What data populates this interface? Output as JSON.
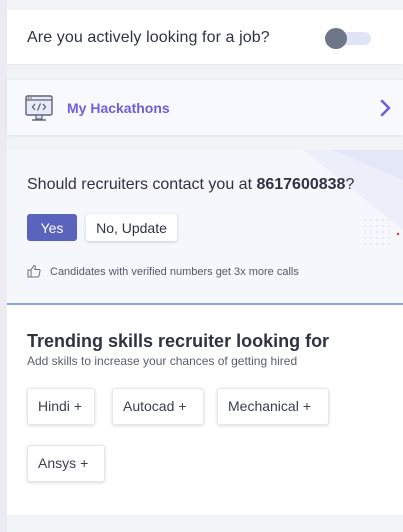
{
  "job_card": {
    "question": "Are you actively looking for a job?",
    "toggle_state": "off"
  },
  "hackathons": {
    "label": "My Hackathons",
    "icon": "code-monitor-icon",
    "chevron_icon": "chevron-right-icon"
  },
  "contact": {
    "question_prefix": "Should recruiters contact you at ",
    "phone": "8617600838",
    "question_suffix": "?",
    "yes_label": "Yes",
    "update_label": "No, Update",
    "hint_icon": "thumbs-up-icon",
    "hint": "Candidates with verified numbers get 3x more calls"
  },
  "skills": {
    "title": "Trending skills recruiter looking for",
    "subtitle": "Add skills to increase your chances of getting hired",
    "chips": [
      {
        "label": "Hindi",
        "plus": "+"
      },
      {
        "label": "Autocad",
        "plus": "+"
      },
      {
        "label": "Mechanical",
        "plus": "+"
      },
      {
        "label": "Ansys",
        "plus": "+"
      }
    ]
  },
  "colors": {
    "accent": "#5a64bd",
    "hackathon_label": "#6e5fd6",
    "contact_bg": "#f6f7fd",
    "contact_border": "#8fa1e6"
  }
}
